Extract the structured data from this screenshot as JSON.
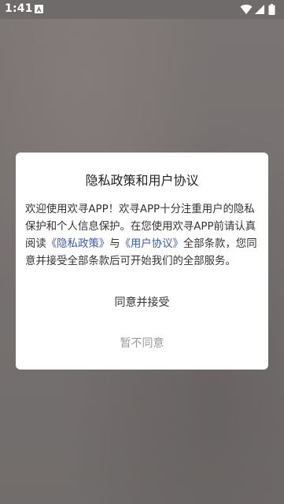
{
  "status_bar": {
    "time": "1:41",
    "notification_icon": "app-notification-icon",
    "icons": [
      "wifi-icon",
      "signal-icon",
      "battery-icon"
    ]
  },
  "dialog": {
    "title": "隐私政策和用户协议",
    "body": {
      "part1": "欢迎使用欢寻APP！欢寻APP十分注重用户的隐私保护和个人信息保护。在您使用欢寻APP前请认真阅读",
      "privacy_link": "《隐私政策》",
      "connector": "与",
      "terms_link": "《用户协议》",
      "part2": "全部条款，您同意并接受全部条款后可开始我们的全部服务。"
    },
    "agree_label": "同意并接受",
    "disagree_label": "暂不同意"
  },
  "colors": {
    "overlay": "#757170",
    "dialog_bg": "#ffffff",
    "link": "#3a5aa8",
    "disabled_text": "#9a9a9a"
  }
}
